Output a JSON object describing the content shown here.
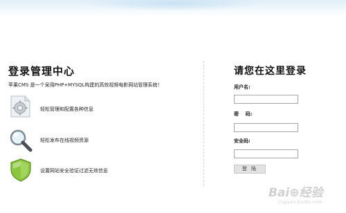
{
  "left_panel": {
    "title": "登录管理中心",
    "intro": "苹果CMS 是一个采用PHP+MYSQL构建的高效视频电影网站管理系统！",
    "features": [
      {
        "icon": "settings-gear-icon",
        "text": "轻松管理和配置各种信息"
      },
      {
        "icon": "magnifier-search-icon",
        "text": "轻松发布在线视频资源"
      },
      {
        "icon": "security-shield-icon",
        "text": "设置网站安全验证过滤无效信息"
      }
    ]
  },
  "login_panel": {
    "title": "请您在这里登录",
    "username_label": "用户名:",
    "username_value": "",
    "password_label": "密    码:",
    "password_value": "",
    "security_label": "安全码:",
    "security_value": "",
    "login_button": "登 陆"
  },
  "watermark": {
    "main": "Bai⊕经验",
    "sub": "jingyan.baidu.com"
  },
  "colors": {
    "top_band": "#dfeef8",
    "shield_green": "#7fbf2a",
    "button_bg": "#e2e2e2"
  }
}
